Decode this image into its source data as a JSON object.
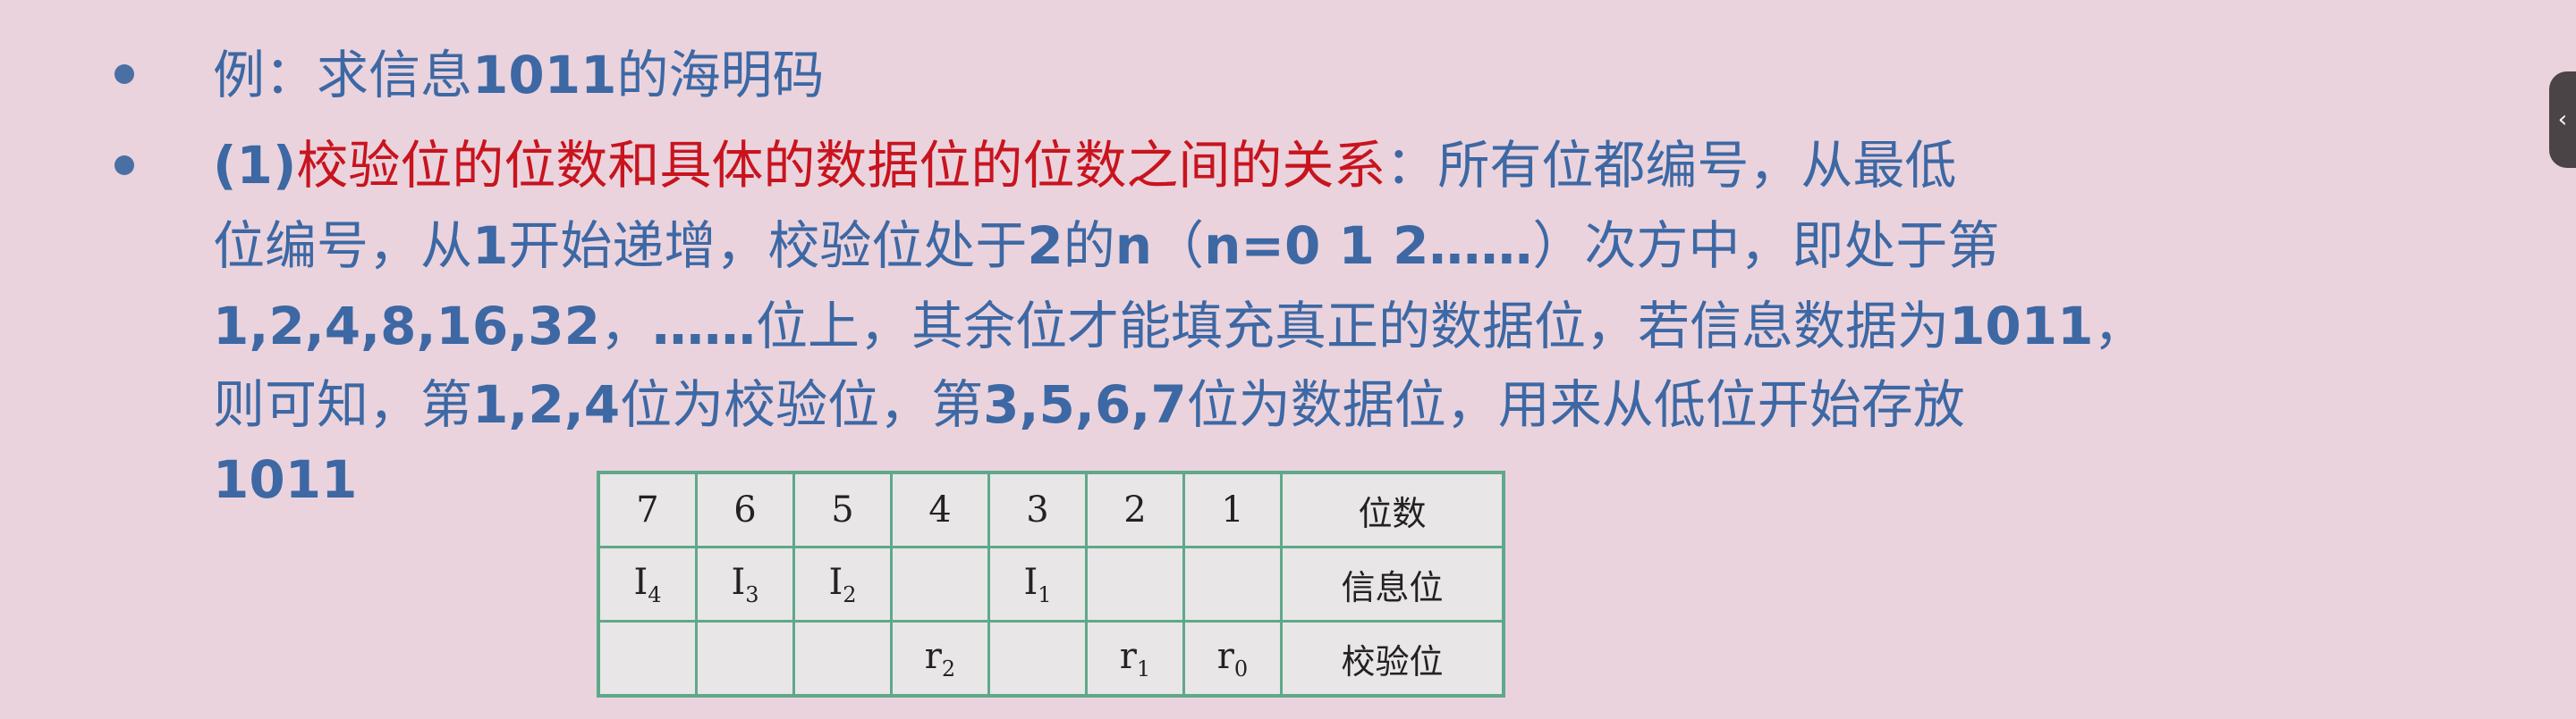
{
  "bullets": [
    {
      "segments": [
        {
          "t": "例：求信息",
          "c": "blue"
        },
        {
          "t": "1011",
          "c": "blue-bold"
        },
        {
          "t": "的海明码",
          "c": "blue"
        }
      ]
    },
    {
      "lines": [
        [
          {
            "t": "(1)",
            "c": "blue-bold"
          },
          {
            "t": "校验位的位数和具体的数据位的位数之间的关系",
            "c": "red"
          },
          {
            "t": "：所有位都编号，从最低",
            "c": "blue"
          }
        ],
        [
          {
            "t": "位编号，从",
            "c": "blue"
          },
          {
            "t": "1",
            "c": "blue-bold"
          },
          {
            "t": "开始递增，校验位处于",
            "c": "blue"
          },
          {
            "t": "2",
            "c": "blue-bold"
          },
          {
            "t": "的",
            "c": "blue"
          },
          {
            "t": "n",
            "c": "blue-bold"
          },
          {
            "t": "（",
            "c": "blue"
          },
          {
            "t": "n=0 1 2……",
            "c": "blue-bold"
          },
          {
            "t": "）次方中，即处于第",
            "c": "blue"
          }
        ],
        [
          {
            "t": "1,2,4,8,16,32",
            "c": "blue-bold"
          },
          {
            "t": "，",
            "c": "blue"
          },
          {
            "t": "……",
            "c": "blue-bold"
          },
          {
            "t": "位上，其余位才能填充真正的数据位，若信息数据为",
            "c": "blue"
          },
          {
            "t": "1011",
            "c": "blue-bold"
          },
          {
            "t": "，",
            "c": "blue"
          }
        ],
        [
          {
            "t": "则可知，第",
            "c": "blue"
          },
          {
            "t": "1,2,4",
            "c": "blue-bold"
          },
          {
            "t": "位为校验位，第",
            "c": "blue"
          },
          {
            "t": "3,5,6,7",
            "c": "blue-bold"
          },
          {
            "t": "位为数据位，用来从低位开始存放",
            "c": "blue"
          }
        ],
        [
          {
            "t": "1011",
            "c": "blue-bold"
          }
        ]
      ]
    }
  ],
  "table": {
    "rows": [
      {
        "cells": [
          [
            "7",
            ""
          ],
          [
            "6",
            ""
          ],
          [
            "5",
            ""
          ],
          [
            "4",
            ""
          ],
          [
            "3",
            ""
          ],
          [
            "2",
            ""
          ],
          [
            "1",
            ""
          ]
        ],
        "label": "位数"
      },
      {
        "cells": [
          [
            "I",
            "4"
          ],
          [
            "I",
            "3"
          ],
          [
            "I",
            "2"
          ],
          [
            "",
            ""
          ],
          [
            "I",
            "1"
          ],
          [
            "",
            ""
          ],
          [
            "",
            ""
          ]
        ],
        "label": "信息位"
      },
      {
        "cells": [
          [
            "",
            ""
          ],
          [
            "",
            ""
          ],
          [
            "",
            ""
          ],
          [
            "r",
            "2"
          ],
          [
            "",
            ""
          ],
          [
            "r",
            "1"
          ],
          [
            "r",
            "0"
          ]
        ],
        "label": "校验位"
      }
    ]
  },
  "side_tab": {
    "icon": "chevron-left-icon",
    "glyph": "‹"
  },
  "colors": {
    "text": "#3d68a4",
    "highlight": "#c8141e",
    "background": "#ead3dd",
    "table_border": "#5fa88a"
  }
}
